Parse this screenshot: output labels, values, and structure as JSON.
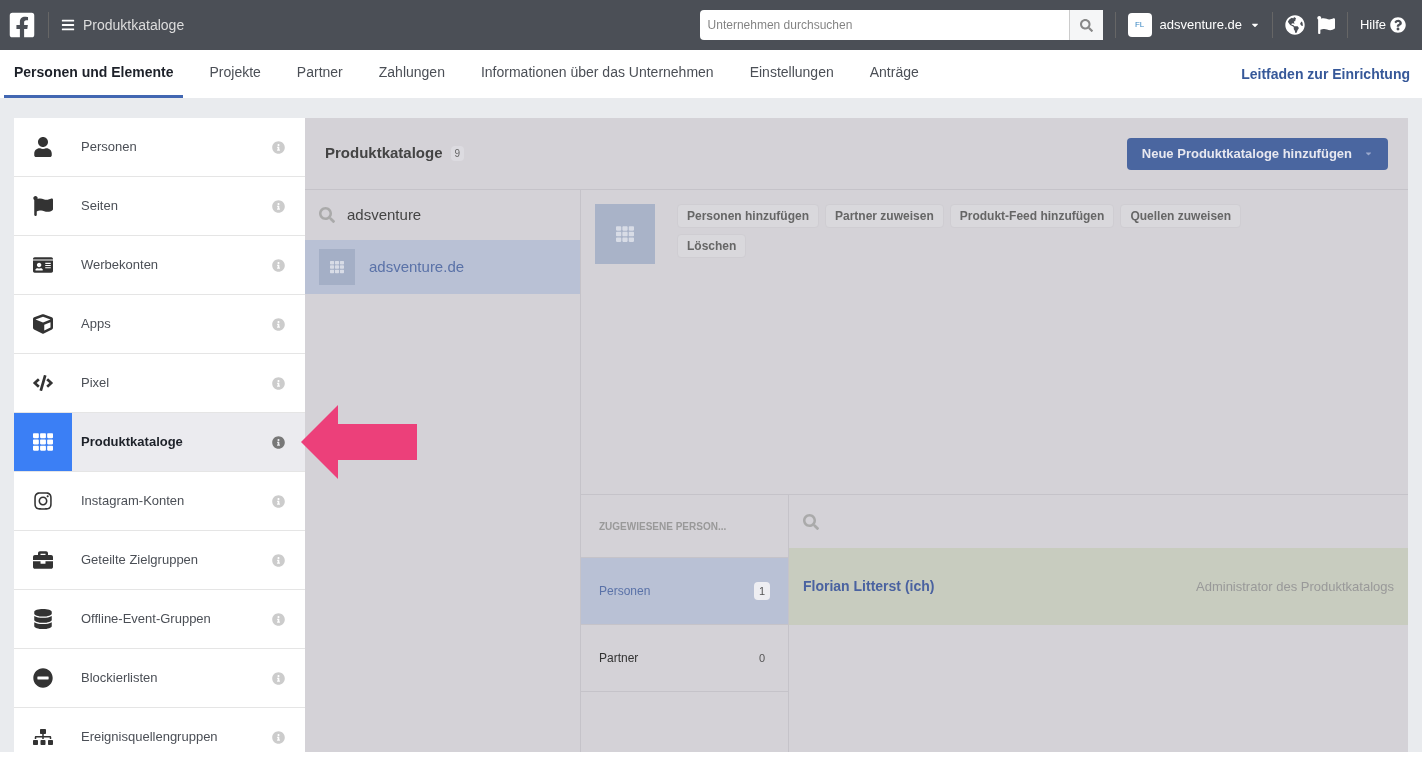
{
  "top_bar": {
    "title": "Produktkataloge",
    "search": {
      "placeholder": "Unternehmen durchsuchen"
    },
    "account": {
      "initials": "FL",
      "name": "adsventure.de"
    },
    "help": "Hilfe"
  },
  "tabs": [
    {
      "label": "Personen und Elemente",
      "selected": true
    },
    {
      "label": "Projekte",
      "selected": false
    },
    {
      "label": "Partner",
      "selected": false
    },
    {
      "label": "Zahlungen",
      "selected": false
    },
    {
      "label": "Informationen über das Unternehmen",
      "selected": false
    },
    {
      "label": "Einstellungen",
      "selected": false
    },
    {
      "label": "Anträge",
      "selected": false
    }
  ],
  "setup_link": "Leitfaden zur Einrichtung",
  "sidebar": {
    "items": [
      {
        "label": "Personen",
        "kind": "person",
        "selected": false
      },
      {
        "label": "Seiten",
        "kind": "flag",
        "selected": false
      },
      {
        "label": "Werbekonten",
        "kind": "ad",
        "selected": false
      },
      {
        "label": "Apps",
        "kind": "cube",
        "selected": false
      },
      {
        "label": "Pixel",
        "kind": "pixel",
        "selected": false
      },
      {
        "label": "Produktkataloge",
        "kind": "grid",
        "selected": true
      },
      {
        "label": "Instagram-Konten",
        "kind": "instagram",
        "selected": false
      },
      {
        "label": "Geteilte Zielgruppen",
        "kind": "briefcase",
        "selected": false
      },
      {
        "label": "Offline-Event-Gruppen",
        "kind": "database",
        "selected": false
      },
      {
        "label": "Blockierlisten",
        "kind": "block",
        "selected": false
      },
      {
        "label": "Ereignisquellengruppen",
        "kind": "network",
        "selected": false
      }
    ]
  },
  "panel": {
    "title": "Produktkataloge",
    "count": "9",
    "add_button": "Neue Produktkataloge hinzufügen",
    "list_search": {
      "value": "adsventure"
    },
    "list": [
      {
        "label": "adsventure.de",
        "selected": true
      }
    ],
    "actions": [
      "Personen hinzufügen",
      "Partner zuweisen",
      "Produkt-Feed hinzufügen",
      "Quellen zuweisen",
      "Löschen"
    ],
    "assigned": {
      "heading": "ZUGEWIESENE PERSON...",
      "categories": [
        {
          "label": "Personen",
          "count": "1",
          "selected": true
        },
        {
          "label": "Partner",
          "count": "0",
          "selected": false
        }
      ],
      "people": [
        {
          "name": "Florian Litterst (ich)",
          "role": "Administrator des Produktkatalogs"
        }
      ]
    }
  }
}
